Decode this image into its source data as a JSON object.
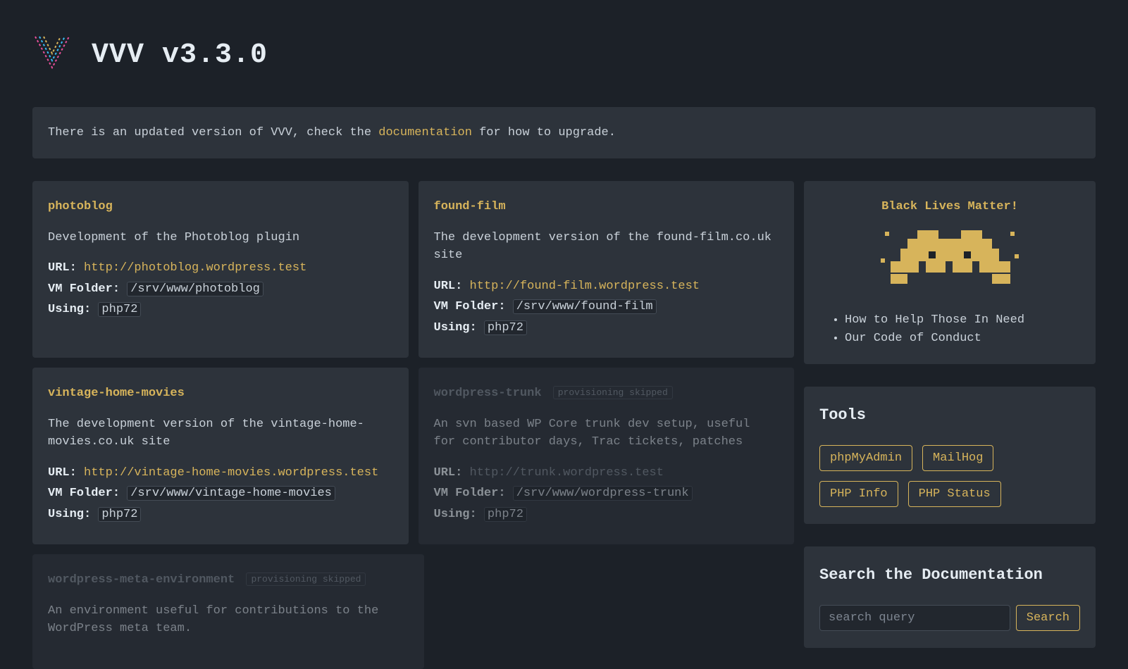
{
  "header": {
    "title": "VVV v3.3.0"
  },
  "banner": {
    "prefix": "There is an updated version of VVV, check the ",
    "link": "documentation",
    "suffix": " for how to upgrade."
  },
  "labels": {
    "url": "URL:",
    "vm_folder": "VM Folder:",
    "using": "Using:",
    "skipped": "provisioning skipped"
  },
  "sites": [
    {
      "name": "photoblog",
      "desc": "Development of the Photoblog plugin",
      "url": "http://photoblog.wordpress.test",
      "folder": "/srv/www/photoblog",
      "using": "php72",
      "skipped": false
    },
    {
      "name": "found-film",
      "desc": "The development version of the found-film.co.uk site",
      "url": "http://found-film.wordpress.test",
      "folder": "/srv/www/found-film",
      "using": "php72",
      "skipped": false
    },
    {
      "name": "vintage-home-movies",
      "desc": "The development version of the vintage-home-movies.co.uk site",
      "url": "http://vintage-home-movies.wordpress.test",
      "folder": "/srv/www/vintage-home-movies",
      "using": "php72",
      "skipped": false
    },
    {
      "name": "wordpress-trunk",
      "desc": "An svn based WP Core trunk dev setup, useful for contributor days, Trac tickets, patches",
      "url": "http://trunk.wordpress.test",
      "folder": "/srv/www/wordpress-trunk",
      "using": "php72",
      "skipped": true
    },
    {
      "name": "wordpress-meta-environment",
      "desc": "An environment useful for contributions to the WordPress meta team.",
      "url": "",
      "folder": "",
      "using": "",
      "skipped": true
    }
  ],
  "blm": {
    "title": "Black Lives Matter!",
    "links": [
      "How to Help Those In Need",
      "Our Code of Conduct"
    ]
  },
  "tools": {
    "title": "Tools",
    "items": [
      "phpMyAdmin",
      "MailHog",
      "PHP Info",
      "PHP Status"
    ]
  },
  "search": {
    "title": "Search the Documentation",
    "placeholder": "search query",
    "button": "Search"
  }
}
